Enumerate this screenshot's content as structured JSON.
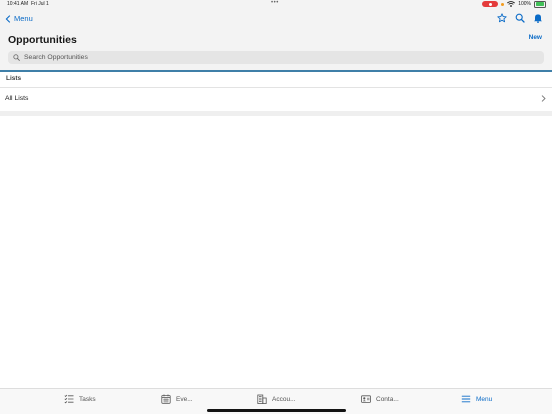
{
  "status_bar": {
    "time": "10:41 AM",
    "date": "Fri Jul 1",
    "dots": "•••",
    "battery": "100%"
  },
  "header": {
    "back_label": "Menu",
    "title": "Opportunities",
    "new_label": "New",
    "icons": [
      "star-icon",
      "search-icon",
      "bell-icon"
    ]
  },
  "search": {
    "placeholder": "Search Opportunities",
    "value": ""
  },
  "lists": {
    "section_label": "Lists",
    "items": [
      {
        "label": "All Lists"
      }
    ]
  },
  "tab_bar": {
    "tabs": [
      {
        "label": "Tasks",
        "icon": "tasks-icon"
      },
      {
        "label": "Eve...",
        "icon": "calendar-icon"
      },
      {
        "label": "Accou...",
        "icon": "building-icon"
      },
      {
        "label": "Conta...",
        "icon": "contact-card-icon"
      },
      {
        "label": "Menu",
        "icon": "menu-icon"
      }
    ],
    "active": "Menu"
  },
  "colors": {
    "accent": "#0b6bc7",
    "divider_accent": "#3f7fa8",
    "header_bg": "#f3f3f3"
  }
}
